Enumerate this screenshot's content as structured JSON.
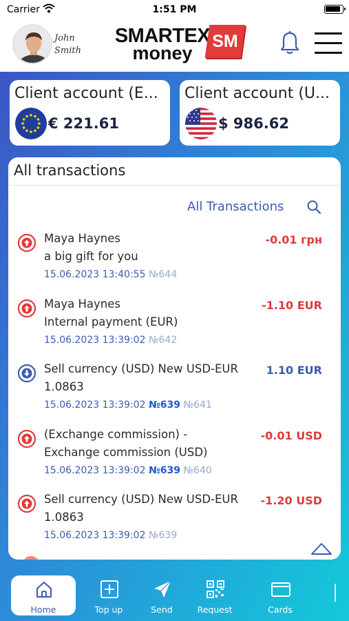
{
  "status_bar": {
    "carrier": "Carrier",
    "time": "1:51 PM"
  },
  "header": {
    "user": {
      "first_name": "John",
      "last_name": "Smith"
    },
    "logo": {
      "line1": "SMARTEX",
      "line2": "money",
      "badge": "SM"
    },
    "icons": [
      "bell-icon",
      "menu-icon"
    ]
  },
  "accounts": [
    {
      "title": "Client account (E...",
      "amount": "€ 221.61",
      "flag": "eu-flag-icon"
    },
    {
      "title": "Client account (U...",
      "amount": "$ 986.62",
      "flag": "us-flag-icon"
    }
  ],
  "transactions_panel": {
    "title": "All transactions",
    "filter_label": "All Transactions",
    "items": [
      {
        "direction": "out",
        "line1": "Maya Haynes",
        "line2": "a big gift for you",
        "datetime": "15.06.2023 13:40:55",
        "ref": "",
        "number": "№644",
        "amount": "-0.01 грн"
      },
      {
        "direction": "out",
        "line1": "Maya Haynes",
        "line2": "Internal payment (EUR)",
        "datetime": "15.06.2023 13:39:02",
        "ref": "",
        "number": "№642",
        "amount": "-1.10 EUR"
      },
      {
        "direction": "in",
        "line1": "Sell currency (USD) New USD-EUR",
        "line2": "1.0863",
        "datetime": "15.06.2023 13:39:02",
        "ref": "№639",
        "number": "№641",
        "amount": "1.10 EUR"
      },
      {
        "direction": "out",
        "line1": "(Exchange commission) -",
        "line2": "Exchange commission (USD)",
        "datetime": "15.06.2023 13:39:02",
        "ref": "№639",
        "number": "№640",
        "amount": "-0.01 USD"
      },
      {
        "direction": "out",
        "line1": "Sell currency (USD) New USD-EUR",
        "line2": "1.0863",
        "datetime": "15.06.2023 13:39:02",
        "ref": "",
        "number": "№639",
        "amount": "-1.20 USD"
      }
    ]
  },
  "tabbar": {
    "tabs": [
      {
        "label": "Home",
        "icon": "home-icon",
        "active": true
      },
      {
        "label": "Top up",
        "icon": "plus-square-icon",
        "active": false
      },
      {
        "label": "Send",
        "icon": "send-icon",
        "active": false
      },
      {
        "label": "Request",
        "icon": "qr-code-icon",
        "active": false
      },
      {
        "label": "Cards",
        "icon": "card-icon",
        "active": false
      }
    ]
  },
  "colors": {
    "accent": "#3a5bb0",
    "negative": "#e23a3a",
    "logo_red": "#e23b3b",
    "gradient_start": "#3d4fc2",
    "gradient_end": "#13c9d9"
  }
}
